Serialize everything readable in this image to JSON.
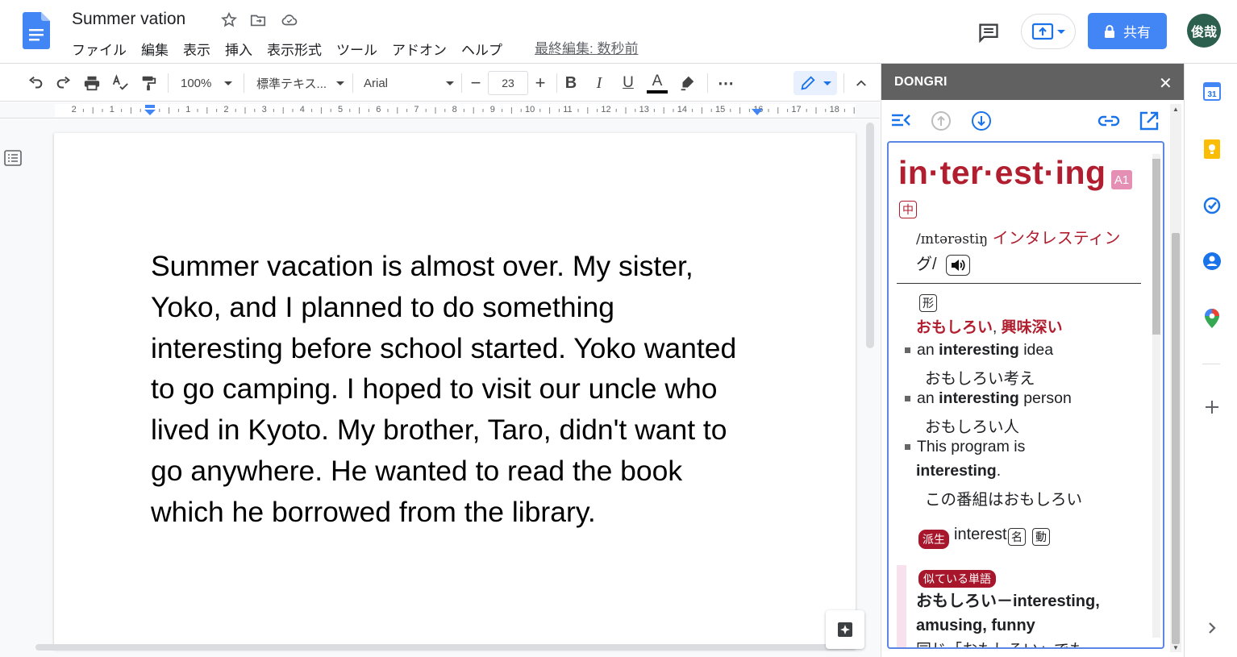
{
  "header": {
    "doc_title": "Summer vation",
    "menu": [
      "ファイル",
      "編集",
      "表示",
      "挿入",
      "表示形式",
      "ツール",
      "アドオン",
      "ヘルプ"
    ],
    "last_edit": "最終編集: 数秒前",
    "share_label": "共有",
    "avatar_text": "俊哉"
  },
  "toolbar": {
    "zoom": "100%",
    "style": "標準テキス...",
    "font": "Arial",
    "font_size": "23",
    "bold": "B",
    "italic": "I",
    "underline": "U",
    "text_color_glyph": "A",
    "more": "⋯"
  },
  "ruler": {
    "labels": [
      "2",
      "1",
      "1",
      "2",
      "3",
      "4",
      "5",
      "6",
      "7",
      "8",
      "9",
      "10",
      "11",
      "12",
      "13",
      "14",
      "15",
      "16",
      "17",
      "18"
    ]
  },
  "document": {
    "paragraph": "Summer vacation is almost over. My sister, Yoko, and I planned to do something interesting before school started.  Yoko wanted to go camping. I hoped to visit our uncle who lived in Kyoto.  My brother, Taro, didn't want to go anywhere.  He wanted to read the book which he borrowed from the library."
  },
  "panel": {
    "title": "DONGRI",
    "close": "✕",
    "entry": {
      "headword": "in·ter·est·ing",
      "level": "A1",
      "chu": "中",
      "ipa": "/ɪntərəstiŋ",
      "kana": "インタレスティン",
      "kana2": "グ/",
      "pos": "形",
      "meaning1": "おもしろい",
      "comma": ",",
      "meaning2": "興味深い",
      "examples": [
        {
          "pre": "an ",
          "bold": "interesting",
          "post": " idea",
          "ja": "おもしろい考え"
        },
        {
          "pre": "an ",
          "bold": "interesting",
          "post": " person",
          "ja": "おもしろい人"
        },
        {
          "pre": "This program is",
          "bold": "interesting",
          "post": ".",
          "ja": "この番組はおもしろい"
        }
      ],
      "derivative_badge": "派生",
      "derivative_word": "interest",
      "derivative_k1": "名",
      "derivative_k2": "動",
      "similar_badge": "似ている単語",
      "similar_text": "おもしろい－interesting, amusing, funny",
      "similar_extra": "同じ「おもしろい」でも"
    }
  },
  "colors": {
    "accent": "#4285f4",
    "dict_red": "#b01e2f",
    "panel_header": "#616161"
  }
}
